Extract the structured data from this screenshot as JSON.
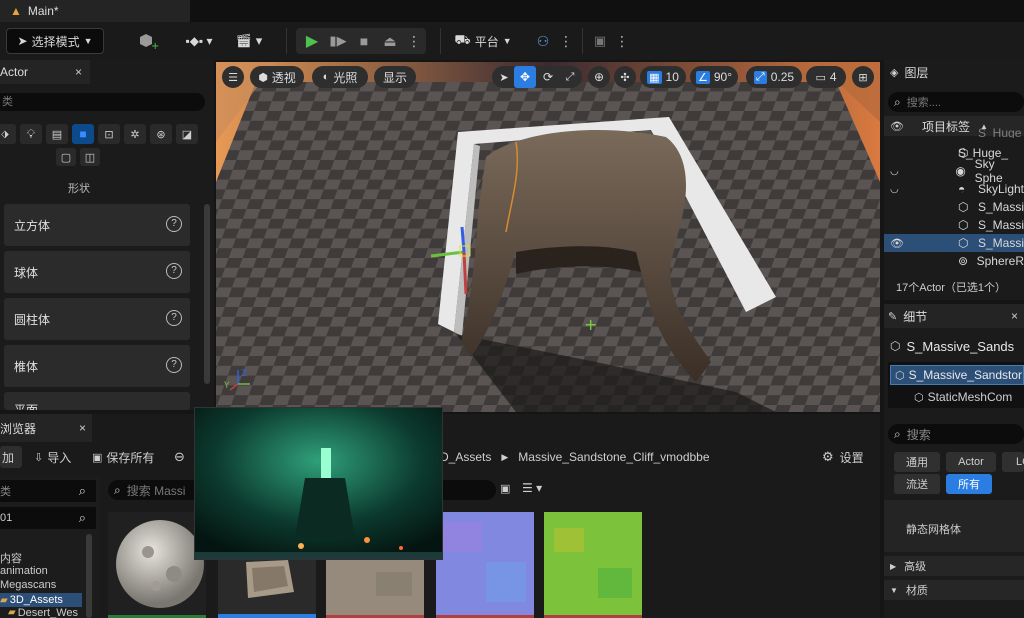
{
  "title_bar": {
    "tab_label": "Main*"
  },
  "toolbar": {
    "select_mode_label": "选择模式",
    "platform_label": "平台"
  },
  "place_actors": {
    "tab_label": "Actor",
    "search_placeholder": "类",
    "category_label": "形状",
    "items": [
      "立方体",
      "球体",
      "圆柱体",
      "椎体",
      "平面"
    ]
  },
  "viewport": {
    "perspective_label": "透视",
    "lighting_label": "光照",
    "show_label": "显示",
    "grid_snap_value": "10",
    "rotate_snap_value": "90°",
    "scale_snap_value": "0.25",
    "camera_speed_value": "4"
  },
  "outliner": {
    "tab_label": "图层",
    "search_placeholder": "搜索....",
    "column_label": "项目标签",
    "rows": [
      "S_Huge_",
      "S_Huge_",
      "Sky Sphe",
      "SkyLight",
      "S_Massi",
      "S_Massi",
      "S_Massi",
      "SphereR"
    ],
    "count_label": "17个Actor（已选1个）"
  },
  "details": {
    "tab_label": "细节",
    "object_name": "S_Massive_Sands",
    "selected_component": "S_Massive_Sandstor",
    "sub_component": "StaticMeshCom",
    "search_placeholder": "搜索",
    "filter_buttons": [
      "通用",
      "Actor",
      "LC",
      "流送",
      "所有"
    ],
    "static_mesh_label": "静态网格体",
    "section_advanced": "高级",
    "section_material": "材质"
  },
  "content_browser": {
    "tab_label": "浏览器",
    "add_label": "加",
    "import_label": "导入",
    "save_all_label": "保存所有",
    "breadcrumb_prev": "D_Assets",
    "breadcrumb_current": "Massive_Sandstone_Cliff_vmodbbe",
    "settings_label": "设置",
    "search_placeholder": "搜索 Massi",
    "sources_filter_label": "类",
    "sources_search_value": "01",
    "tree": [
      "内容",
      "animation",
      "Megascans",
      "3D_Assets",
      "Desert_Wes"
    ]
  },
  "colors": {
    "accent_blue": "#2b7de1",
    "play_green": "#4ec24e",
    "selection_row": "#2c4f78"
  }
}
